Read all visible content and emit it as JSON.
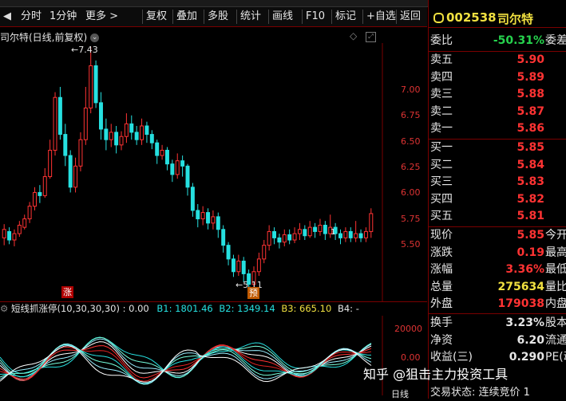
{
  "colors": {
    "up": "#ff3333",
    "down": "#26e0e0",
    "axis": "#d33",
    "accent_yellow": "#f0e040"
  },
  "toolbar": {
    "items": [
      "分时",
      "1分钟",
      "更多 >",
      "复权",
      "叠加",
      "多股",
      "统计",
      "画线",
      "F10",
      "标记",
      "+自选",
      "返回"
    ],
    "nav_icons": [
      "back-arrow-icon",
      "forward-arrow-icon"
    ]
  },
  "chart": {
    "title": "司尔特(日线,前复权)",
    "title_icon": "chevron-down-icon",
    "header_icons": [
      "diamond-icon",
      "expand-icon"
    ],
    "high_label": "7.43",
    "low_label": "5.11",
    "badge_up": "涨",
    "badge_pre": "预",
    "last_label": "1"
  },
  "chart_data": {
    "type": "candlestick",
    "ylim": [
      5.2,
      7.45
    ],
    "yticks": [
      "7.00",
      "6.75",
      "6.50",
      "6.25",
      "6.00",
      "5.75",
      "5.50"
    ],
    "candles": [
      [
        5.62,
        5.7,
        5.55,
        5.75
      ],
      [
        5.68,
        5.6,
        5.56,
        5.72
      ],
      [
        5.6,
        5.66,
        5.54,
        5.7
      ],
      [
        5.66,
        5.74,
        5.63,
        5.78
      ],
      [
        5.72,
        5.8,
        5.7,
        5.84
      ],
      [
        5.8,
        5.92,
        5.76,
        5.96
      ],
      [
        5.92,
        6.05,
        5.88,
        6.1
      ],
      [
        6.05,
        6.02,
        5.95,
        6.12
      ],
      [
        6.02,
        6.2,
        6.0,
        6.28
      ],
      [
        6.2,
        6.45,
        6.18,
        6.55
      ],
      [
        6.45,
        6.95,
        6.4,
        7.0
      ],
      [
        6.95,
        6.6,
        6.55,
        7.05
      ],
      [
        6.6,
        6.4,
        6.3,
        6.7
      ],
      [
        6.4,
        6.1,
        6.05,
        6.45
      ],
      [
        6.1,
        6.3,
        6.05,
        6.38
      ],
      [
        6.3,
        6.55,
        6.25,
        6.62
      ],
      [
        6.55,
        6.85,
        6.5,
        7.05
      ],
      [
        6.85,
        7.25,
        6.8,
        7.43
      ],
      [
        7.25,
        6.9,
        6.85,
        7.3
      ],
      [
        6.9,
        6.65,
        6.55,
        7.0
      ],
      [
        6.65,
        6.55,
        6.45,
        6.75
      ],
      [
        6.55,
        6.62,
        6.48,
        6.7
      ],
      [
        6.62,
        6.5,
        6.42,
        6.68
      ],
      [
        6.5,
        6.58,
        6.45,
        6.63
      ],
      [
        6.58,
        6.7,
        6.52,
        6.8
      ],
      [
        6.7,
        6.62,
        6.55,
        6.78
      ],
      [
        6.62,
        6.55,
        6.5,
        6.68
      ],
      [
        6.55,
        6.68,
        6.5,
        6.75
      ],
      [
        6.68,
        6.6,
        6.52,
        6.72
      ],
      [
        6.6,
        6.52,
        6.46,
        6.64
      ],
      [
        6.52,
        6.4,
        6.32,
        6.55
      ],
      [
        6.4,
        6.45,
        6.36,
        6.5
      ],
      [
        6.45,
        6.32,
        6.26,
        6.48
      ],
      [
        6.32,
        6.22,
        6.15,
        6.36
      ],
      [
        6.22,
        6.35,
        6.18,
        6.42
      ],
      [
        6.35,
        6.3,
        6.2,
        6.4
      ],
      [
        6.3,
        6.1,
        6.02,
        6.32
      ],
      [
        6.1,
        5.88,
        5.82,
        6.14
      ],
      [
        5.88,
        5.8,
        5.72,
        5.94
      ],
      [
        5.8,
        5.86,
        5.74,
        5.92
      ],
      [
        5.86,
        5.76,
        5.7,
        5.9
      ],
      [
        5.76,
        5.82,
        5.7,
        5.88
      ],
      [
        5.82,
        5.7,
        5.62,
        5.86
      ],
      [
        5.7,
        5.55,
        5.48,
        5.74
      ],
      [
        5.55,
        5.42,
        5.36,
        5.58
      ],
      [
        5.42,
        5.3,
        5.25,
        5.46
      ],
      [
        5.3,
        5.4,
        5.26,
        5.46
      ],
      [
        5.4,
        5.28,
        5.2,
        5.44
      ],
      [
        5.28,
        5.18,
        5.11,
        5.32
      ],
      [
        5.18,
        5.3,
        5.14,
        5.35
      ],
      [
        5.3,
        5.42,
        5.26,
        5.48
      ],
      [
        5.42,
        5.55,
        5.38,
        5.6
      ],
      [
        5.55,
        5.68,
        5.5,
        5.74
      ],
      [
        5.68,
        5.62,
        5.56,
        5.72
      ],
      [
        5.62,
        5.58,
        5.52,
        5.66
      ],
      [
        5.58,
        5.65,
        5.54,
        5.7
      ],
      [
        5.65,
        5.6,
        5.56,
        5.7
      ],
      [
        5.6,
        5.66,
        5.57,
        5.72
      ],
      [
        5.66,
        5.7,
        5.6,
        5.76
      ],
      [
        5.7,
        5.64,
        5.6,
        5.74
      ],
      [
        5.64,
        5.72,
        5.62,
        5.78
      ],
      [
        5.72,
        5.68,
        5.62,
        5.76
      ],
      [
        5.68,
        5.74,
        5.64,
        5.8
      ],
      [
        5.74,
        5.66,
        5.6,
        5.78
      ],
      [
        5.66,
        5.72,
        5.62,
        5.84
      ],
      [
        5.72,
        5.66,
        5.6,
        5.76
      ],
      [
        5.66,
        5.62,
        5.56,
        5.7
      ],
      [
        5.62,
        5.68,
        5.58,
        5.72
      ],
      [
        5.68,
        5.62,
        5.58,
        5.72
      ],
      [
        5.62,
        5.66,
        5.58,
        5.78
      ],
      [
        5.66,
        5.62,
        5.58,
        5.7
      ],
      [
        5.62,
        5.68,
        5.58,
        5.72
      ],
      [
        5.68,
        5.85,
        5.62,
        5.9
      ]
    ]
  },
  "indicator": {
    "name": "短线抓涨停(10,30,30,30)",
    "value": ": 0.00",
    "b1": "B1: 1801.46",
    "b2": "B2: 1349.14",
    "b3": "B3: 665.10",
    "b4": "B4: -",
    "yticks": [
      "20000",
      "0.00"
    ]
  },
  "panel": {
    "code": "002538",
    "name": "司尔特",
    "weibi": {
      "label": "委比",
      "value": "-50.31%",
      "tail": "委差"
    },
    "asks": [
      {
        "label": "卖五",
        "price": "5.90"
      },
      {
        "label": "卖四",
        "price": "5.89"
      },
      {
        "label": "卖三",
        "price": "5.88"
      },
      {
        "label": "卖二",
        "price": "5.87"
      },
      {
        "label": "卖一",
        "price": "5.86"
      }
    ],
    "bids": [
      {
        "label": "买一",
        "price": "5.85"
      },
      {
        "label": "买二",
        "price": "5.84"
      },
      {
        "label": "买三",
        "price": "5.83"
      },
      {
        "label": "买四",
        "price": "5.82"
      },
      {
        "label": "买五",
        "price": "5.81"
      }
    ],
    "stats": [
      {
        "label": "现价",
        "value": "5.85",
        "tail": "今开"
      },
      {
        "label": "涨跌",
        "value": "0.19",
        "tail": "最高"
      },
      {
        "label": "涨幅",
        "value": "3.36%",
        "tail": "最低"
      },
      {
        "label": "总量",
        "value": "275634",
        "tail": "量比"
      },
      {
        "label": "外盘",
        "value": "179038",
        "tail": "内盘"
      }
    ],
    "stats2": [
      {
        "label": "换手",
        "value": "3.23%",
        "tail": "股本"
      },
      {
        "label": "净资",
        "value": "6.20",
        "tail": "流通"
      },
      {
        "label": "收益(三)",
        "value": "0.290",
        "tail": "PE(动)"
      }
    ],
    "trade_status": "交易状态: 连续竞价 1"
  },
  "watermark": "知乎 @狙击主力投资工具",
  "bottom_axis": {
    "labels": [
      "日线"
    ]
  }
}
